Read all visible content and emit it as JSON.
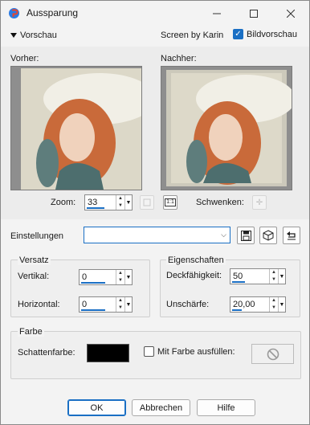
{
  "window": {
    "title": "Aussparung",
    "minimize_icon": "minimize-icon",
    "maximize_icon": "maximize-icon",
    "close_icon": "close-icon"
  },
  "preview": {
    "toggle_label": "Vorschau",
    "credit": "Screen by Karin",
    "show_preview_label": "Bildvorschau",
    "show_preview_checked": true,
    "before_label": "Vorher:",
    "after_label": "Nachher:",
    "zoom_label": "Zoom:",
    "zoom_value": "33",
    "pan_label": "Schwenken:"
  },
  "settings": {
    "label": "Einstellungen",
    "preset_value": ""
  },
  "versatz": {
    "title": "Versatz",
    "vertical_label": "Vertikal:",
    "vertical_value": "0",
    "horizontal_label": "Horizontal:",
    "horizontal_value": "0"
  },
  "eigenschaften": {
    "title": "Eigenschaften",
    "opacity_label": "Deckfähigkeit:",
    "opacity_value": "50",
    "blur_label": "Unschärfe:",
    "blur_value": "20,00"
  },
  "farbe": {
    "title": "Farbe",
    "shadow_color_label": "Schattenfarbe:",
    "shadow_color": "#000000",
    "fill_label": "Mit Farbe ausfüllen:",
    "fill_checked": false
  },
  "buttons": {
    "ok": "OK",
    "cancel": "Abbrechen",
    "help": "Hilfe"
  },
  "colors": {
    "accent": "#1a6fc4",
    "window_bg": "#f3f3f3"
  }
}
